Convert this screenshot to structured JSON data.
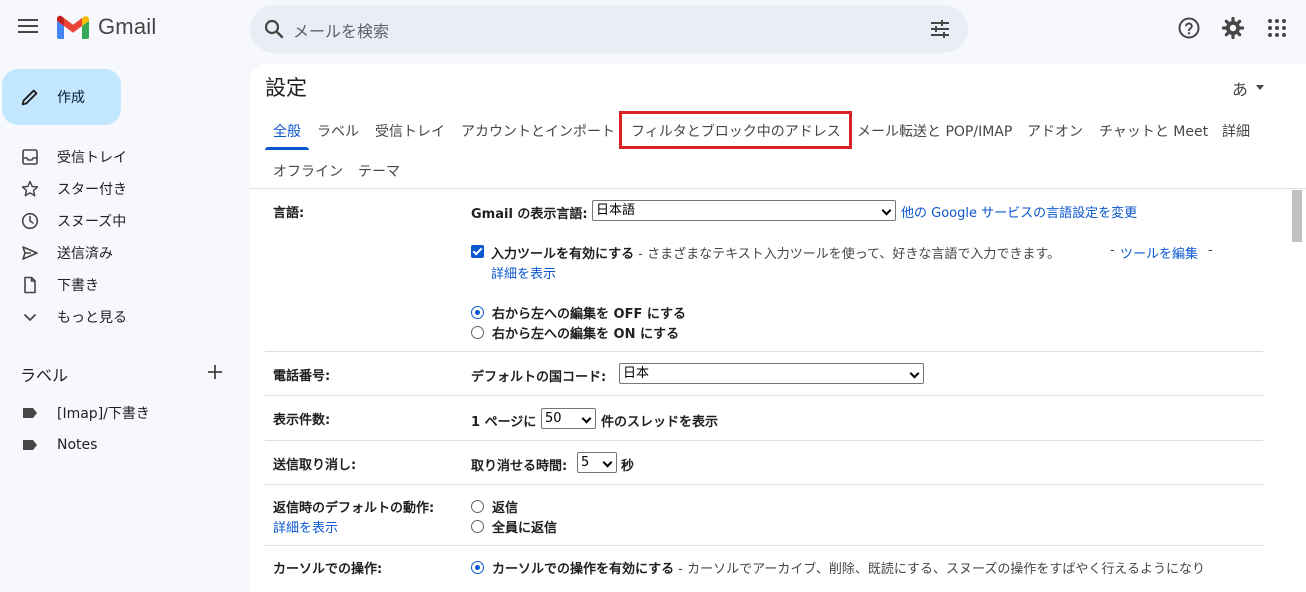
{
  "header": {
    "app_name": "Gmail",
    "search_placeholder": "メールを検索"
  },
  "sidebar": {
    "compose_label": "作成",
    "items": [
      {
        "label": "受信トレイ",
        "icon": "inbox-icon"
      },
      {
        "label": "スター付き",
        "icon": "star-icon"
      },
      {
        "label": "スヌーズ中",
        "icon": "clock-icon"
      },
      {
        "label": "送信済み",
        "icon": "send-icon"
      },
      {
        "label": "下書き",
        "icon": "draft-icon"
      },
      {
        "label": "もっと見る",
        "icon": "chevron-down-icon"
      }
    ],
    "labels_heading": "ラベル",
    "labels": [
      {
        "label": "[Imap]/下書き"
      },
      {
        "label": "Notes"
      }
    ]
  },
  "settings": {
    "title": "設定",
    "input_tool": "あ",
    "tabs": [
      {
        "label": "全般",
        "active": true
      },
      {
        "label": "ラベル"
      },
      {
        "label": "受信トレイ"
      },
      {
        "label": "アカウントとインポート"
      },
      {
        "label": "フィルタとブロック中のアドレス",
        "highlighted": true
      },
      {
        "label": "メール転送と POP/IMAP"
      },
      {
        "label": "アドオン"
      },
      {
        "label": "チャットと Meet"
      },
      {
        "label": "詳細"
      },
      {
        "label": "オフライン"
      },
      {
        "label": "テーマ"
      }
    ],
    "language": {
      "label": "言語:",
      "display_label": "Gmail の表示言語:",
      "display_value": "日本語",
      "other_link": "他の Google サービスの言語設定を変更",
      "input_tools_label": "入力ツールを有効にする",
      "input_tools_desc": " - さまざまなテキスト入力ツールを使って、好きな言語で入力できます。",
      "edit_tools_link": "ツールを編集",
      "dash": "-",
      "details_link": "詳細を表示",
      "rtl_off": "右から左への編集を OFF にする",
      "rtl_on": "右から左への編集を ON にする"
    },
    "phone": {
      "label": "電話番号:",
      "country_label": "デフォルトの国コード:",
      "country_value": "日本"
    },
    "page_size": {
      "label": "表示件数:",
      "prefix": "1 ページに",
      "value": "50",
      "suffix": "件のスレッドを表示"
    },
    "undo_send": {
      "label": "送信取り消し:",
      "prefix": "取り消せる時間:",
      "value": "5",
      "suffix": "秒"
    },
    "reply_default": {
      "label": "返信時のデフォルトの動作:",
      "details_link": "詳細を表示",
      "reply": "返信",
      "reply_all": "全員に返信"
    },
    "cursor": {
      "label": "カーソルでの操作:",
      "enable": "カーソルでの操作を有効にする",
      "desc": " - カーソルでアーカイブ、削除、既読にする、スヌーズの操作をすばやく行えるようになり"
    }
  }
}
